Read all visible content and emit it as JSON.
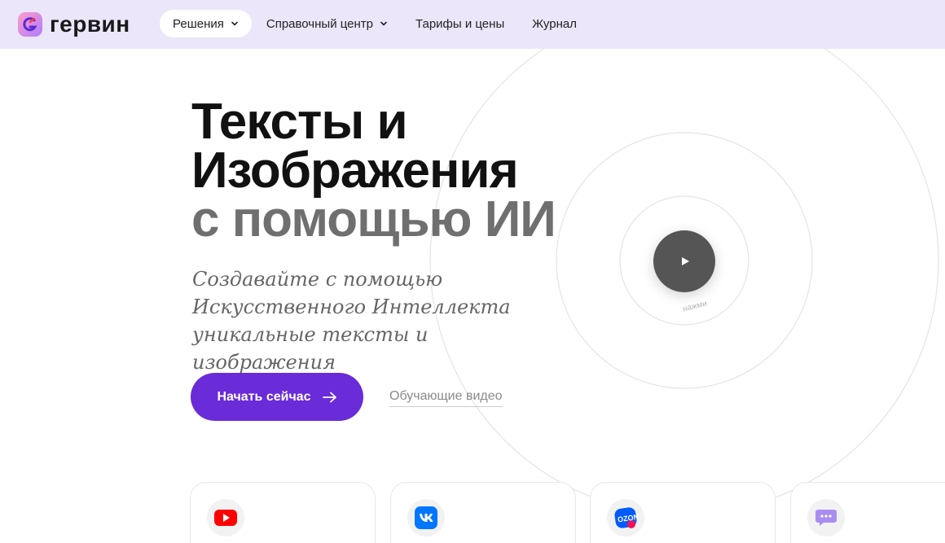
{
  "brand": {
    "name": "гервин",
    "accent": "#6a2bd9",
    "header_bg": "#ece6fb"
  },
  "nav": {
    "items": [
      {
        "label": "Решения",
        "has_dropdown": true,
        "active": true
      },
      {
        "label": "Справочный центр",
        "has_dropdown": true,
        "active": false
      },
      {
        "label": "Тарифы и цены",
        "has_dropdown": false,
        "active": false
      },
      {
        "label": "Журнал",
        "has_dropdown": false,
        "active": false
      }
    ]
  },
  "hero": {
    "title_line1": "Тексты и",
    "title_line2": "Изображения",
    "title_line3": "с помощью ИИ",
    "subtitle": "Создавайте с помощью Искусственного Интеллекта уникальные тексты и изображения",
    "cta_label": "Начать сейчас",
    "video_link": "Обучающие видео",
    "play_hint": "нажми"
  },
  "cards": [
    {
      "icon": "youtube-icon"
    },
    {
      "icon": "vk-icon"
    },
    {
      "icon": "ozon-icon"
    },
    {
      "icon": "chat-icon"
    }
  ]
}
